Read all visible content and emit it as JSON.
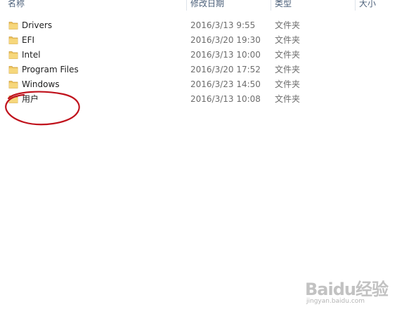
{
  "columns": {
    "name": "名称",
    "modified": "修改日期",
    "type": "类型",
    "size": "大小"
  },
  "rows": [
    {
      "name": "Drivers",
      "modified": "2016/3/13 9:55",
      "type": "文件夹",
      "icon": "folder-icon"
    },
    {
      "name": "EFI",
      "modified": "2016/3/20 19:30",
      "type": "文件夹",
      "icon": "folder-icon"
    },
    {
      "name": "Intel",
      "modified": "2016/3/13 10:00",
      "type": "文件夹",
      "icon": "folder-icon"
    },
    {
      "name": "Program Files",
      "modified": "2016/3/20 17:52",
      "type": "文件夹",
      "icon": "folder-icon"
    },
    {
      "name": "Windows",
      "modified": "2016/3/23 14:50",
      "type": "文件夹",
      "icon": "folder-icon"
    },
    {
      "name": "用户",
      "modified": "2016/3/13 10:08",
      "type": "文件夹",
      "icon": "folder-icon"
    }
  ],
  "annotation": {
    "shape": "ellipse",
    "color": "#c0121c",
    "target_row": "用户"
  },
  "watermark": {
    "logo": "Baidu经验",
    "url": "jingyan.baidu.com"
  },
  "colors": {
    "header_text": "#4c607a",
    "folder": "#f0c560",
    "annotation_red": "#c0121c"
  }
}
